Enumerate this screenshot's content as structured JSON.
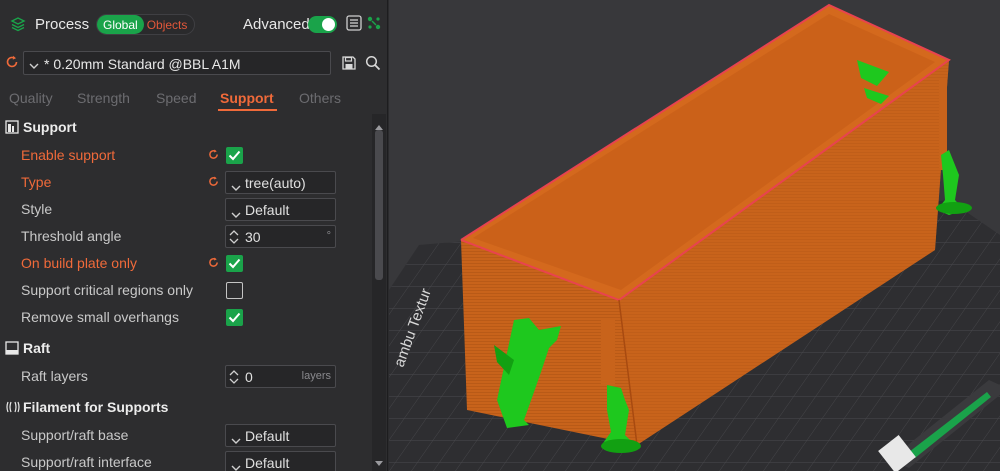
{
  "header": {
    "title": "Process",
    "scope_active": "Global",
    "scope_inactive": "Objects",
    "advanced_label": "Advanced",
    "advanced_on": true
  },
  "preset": {
    "name": "* 0.20mm Standard @BBL A1M"
  },
  "tabs": [
    {
      "label": "Quality",
      "active": false
    },
    {
      "label": "Strength",
      "active": false
    },
    {
      "label": "Speed",
      "active": false
    },
    {
      "label": "Support",
      "active": true
    },
    {
      "label": "Others",
      "active": false
    }
  ],
  "sections": {
    "support": {
      "title": "Support",
      "rows": [
        {
          "label": "Enable support",
          "checked": true
        },
        {
          "label": "Type",
          "value": "tree(auto)"
        },
        {
          "label": "Style",
          "value": "Default"
        },
        {
          "label": "Threshold angle",
          "value": "30",
          "unit": "°"
        },
        {
          "label": "On build plate only",
          "checked": true
        },
        {
          "label": "Support critical regions only",
          "checked": false
        },
        {
          "label": "Remove small overhangs",
          "checked": true
        }
      ]
    },
    "raft": {
      "title": "Raft",
      "rows": [
        {
          "label": "Raft layers",
          "value": "0",
          "unit": "layers"
        }
      ]
    },
    "filament": {
      "title": "Filament for Supports",
      "rows": [
        {
          "label": "Support/raft base",
          "value": "Default"
        },
        {
          "label": "Support/raft interface",
          "value": "Default"
        }
      ]
    }
  },
  "viewport": {
    "plate_text": "ambu Textur"
  },
  "colors": {
    "accent_green": "#1aa34a",
    "modified_orange": "#f06a3a",
    "model_orange": "#c8631b",
    "support_green": "#1ec81e"
  }
}
